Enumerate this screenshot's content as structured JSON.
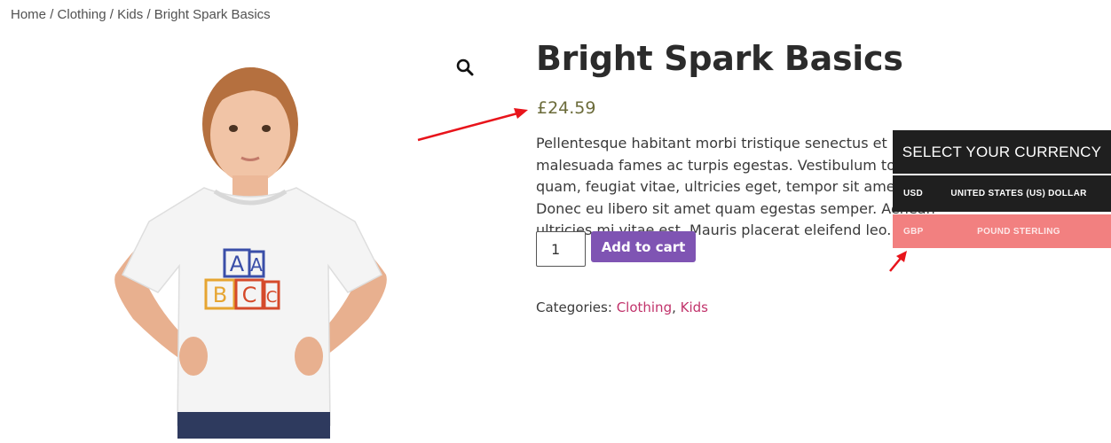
{
  "breadcrumb": {
    "home": "Home",
    "sep": "/",
    "clothing": "Clothing",
    "kids": "Kids",
    "current": "Bright Spark Basics"
  },
  "product": {
    "title": "Bright Spark Basics",
    "price": "£24.59",
    "description": "Pellentesque habitant morbi tristique senectus et netus et malesuada fames ac turpis egestas. Vestibulum tortor quam, feugiat vitae, ultricies eget, tempor sit amet, ante. Donec eu libero sit amet quam egestas semper. Aenean ultricies mi vitae est. Mauris placerat eleifend leo.",
    "quantity": "1",
    "add_to_cart": "Add to cart",
    "categories_label": "Categories:",
    "categories": [
      "Clothing",
      "Kids"
    ],
    "shirt_print": "AA BCC"
  },
  "currency_switcher": {
    "heading": "SELECT YOUR CURRENCY",
    "options": [
      {
        "code": "USD",
        "name": "UNITED STATES (US) DOLLAR"
      },
      {
        "code": "GBP",
        "name": "POUND STERLING"
      }
    ]
  },
  "colors": {
    "button": "#7f54b3",
    "category_link": "#c1336b",
    "currency_dark": "#1f1f1f",
    "currency_selected": "#f28080",
    "arrow": "#e8141b"
  },
  "icons": {
    "zoom": "magnifier-icon"
  }
}
